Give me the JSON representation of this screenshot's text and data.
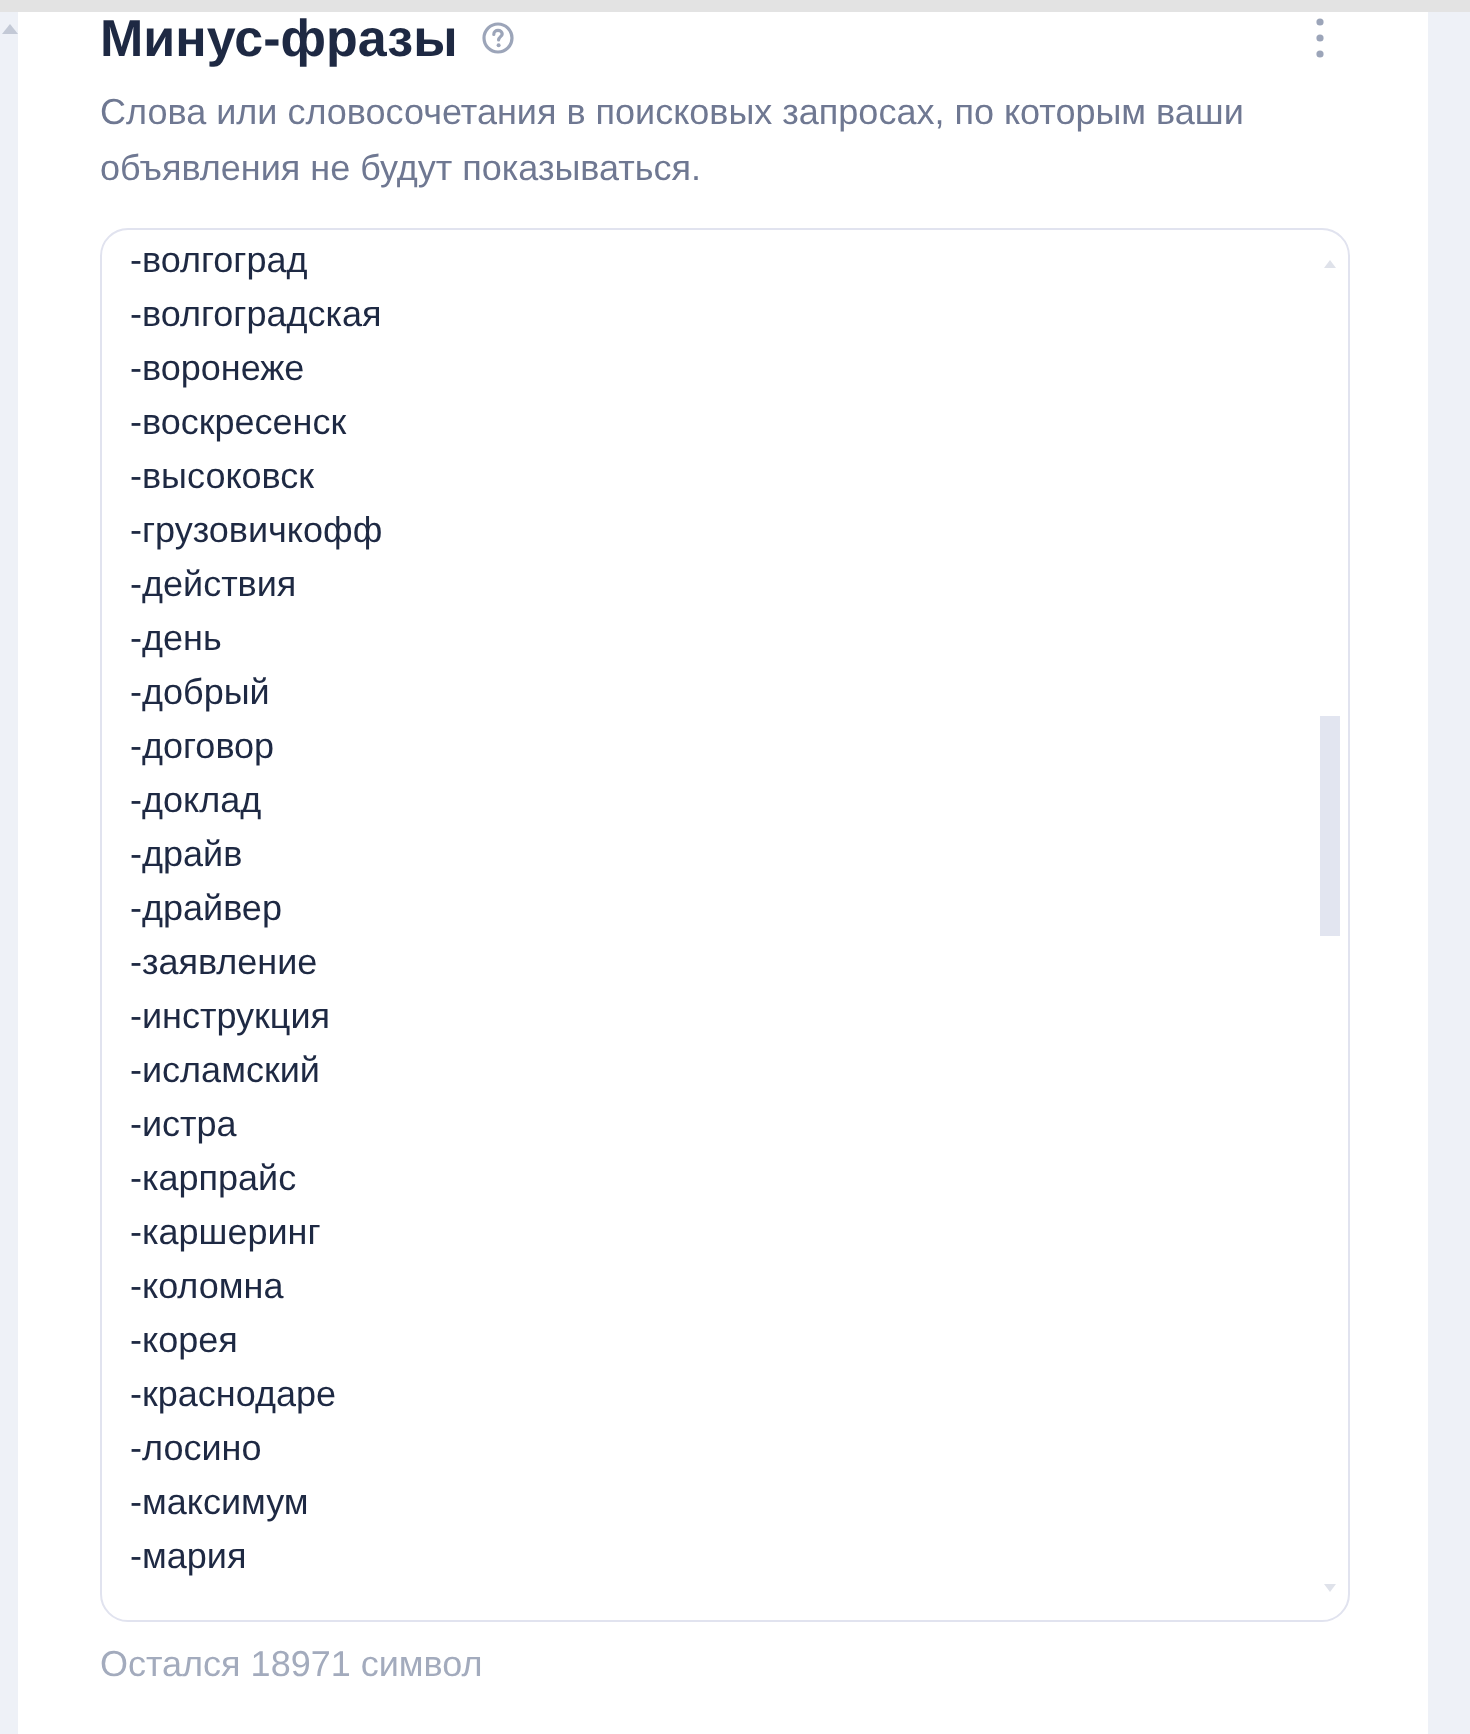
{
  "section": {
    "title": "Минус-фразы",
    "description": "Слова или словосочетания в поисковых запросах, по которым ваши объявления не будут показываться."
  },
  "field": {
    "lines": [
      "-волгоград",
      "-волгоградская",
      "-воронеже",
      "-воскресенск",
      "-высоковск",
      "-грузовичкофф",
      "-действия",
      "-день",
      "-добрый",
      "-договор",
      "-доклад",
      "-драйв",
      "-драйвер",
      "-заявление",
      "-инструкция",
      "-исламский",
      "-истра",
      "-карпрайс",
      "-каршеринг",
      "-коломна",
      "-корея",
      "-краснодаре",
      "-лосино",
      "-максимум",
      "-мария"
    ]
  },
  "counter": "Остался 18971 символ"
}
